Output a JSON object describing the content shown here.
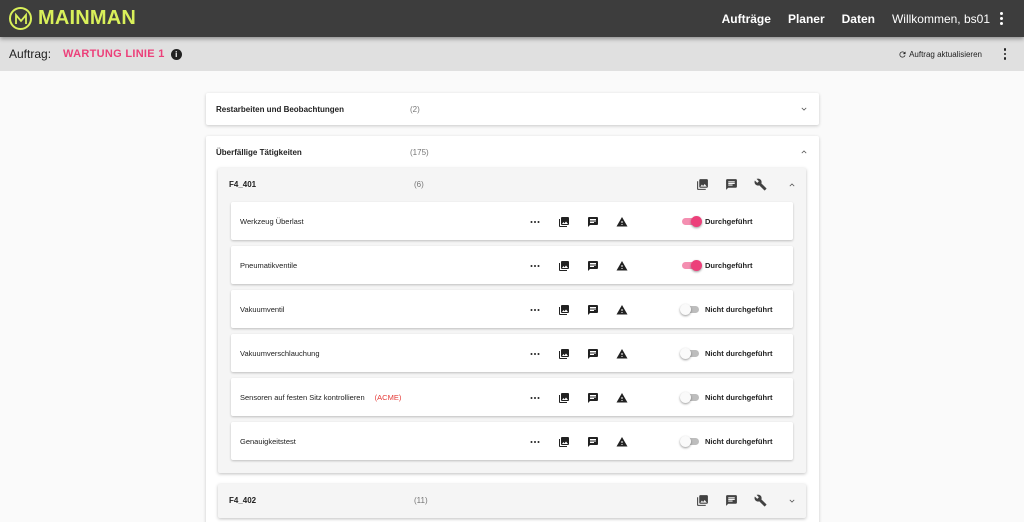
{
  "app": {
    "brand": "MAINMAN",
    "nav": [
      "Aufträge",
      "Planer",
      "Daten"
    ],
    "user_greeting": "Willkommen, bs01"
  },
  "subbar": {
    "auftrag_label": "Auftrag:",
    "auftrag_name": "WARTUNG LINIE 1",
    "refresh_label": "Auftrag aktualisieren"
  },
  "sections": [
    {
      "title": "Restarbeiten und Beobachtungen",
      "count": "(2)",
      "expanded": false
    },
    {
      "title": "Überfällige Tätigkeiten",
      "count": "(175)",
      "expanded": true
    }
  ],
  "groups": [
    {
      "name": "F4_401",
      "count": "(6)",
      "expanded": true,
      "tasks": [
        {
          "name": "Werkzeug Überlast",
          "extra": "",
          "done": true,
          "status": "Durchgeführt"
        },
        {
          "name": "Pneumatikventile",
          "extra": "",
          "done": true,
          "status": "Durchgeführt"
        },
        {
          "name": "Vakuumventil",
          "extra": "",
          "done": false,
          "status": "Nicht durchgeführt"
        },
        {
          "name": "Vakuumverschlauchung",
          "extra": "",
          "done": false,
          "status": "Nicht durchgeführt"
        },
        {
          "name": "Sensoren auf festen Sitz kontrollieren",
          "extra": "(ACME)",
          "done": false,
          "status": "Nicht durchgeführt"
        },
        {
          "name": "Genauigkeitstest",
          "extra": "",
          "done": false,
          "status": "Nicht durchgeführt"
        }
      ]
    },
    {
      "name": "F4_402",
      "count": "(11)",
      "expanded": false,
      "tasks": []
    }
  ],
  "colors": {
    "brand": "#d9f05a",
    "accent": "#ec407a",
    "topbar": "#3d3d3d",
    "warning": "#e53935"
  },
  "icons": [
    "info-icon",
    "refresh-icon",
    "more-icon",
    "gallery-icon",
    "comment-icon",
    "warning-icon",
    "wrench-icon",
    "chevron-up-icon",
    "chevron-down-icon"
  ]
}
